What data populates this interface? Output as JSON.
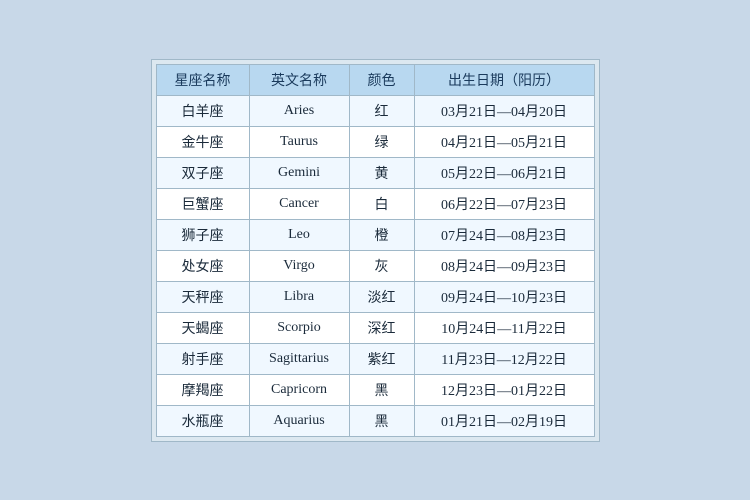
{
  "table": {
    "headers": {
      "chinese_name": "星座名称",
      "english_name": "英文名称",
      "color": "颜色",
      "birth_date": "出生日期（阳历）"
    },
    "rows": [
      {
        "chinese": "白羊座",
        "english": "Aries",
        "color": "红",
        "date": "03月21日—04月20日"
      },
      {
        "chinese": "金牛座",
        "english": "Taurus",
        "color": "绿",
        "date": "04月21日—05月21日"
      },
      {
        "chinese": "双子座",
        "english": "Gemini",
        "color": "黄",
        "date": "05月22日—06月21日"
      },
      {
        "chinese": "巨蟹座",
        "english": "Cancer",
        "color": "白",
        "date": "06月22日—07月23日"
      },
      {
        "chinese": "狮子座",
        "english": "Leo",
        "color": "橙",
        "date": "07月24日—08月23日"
      },
      {
        "chinese": "处女座",
        "english": "Virgo",
        "color": "灰",
        "date": "08月24日—09月23日"
      },
      {
        "chinese": "天秤座",
        "english": "Libra",
        "color": "淡红",
        "date": "09月24日—10月23日"
      },
      {
        "chinese": "天蝎座",
        "english": "Scorpio",
        "color": "深红",
        "date": "10月24日—11月22日"
      },
      {
        "chinese": "射手座",
        "english": "Sagittarius",
        "color": "紫红",
        "date": "11月23日—12月22日"
      },
      {
        "chinese": "摩羯座",
        "english": "Capricorn",
        "color": "黑",
        "date": "12月23日—01月22日"
      },
      {
        "chinese": "水瓶座",
        "english": "Aquarius",
        "color": "黑",
        "date": "01月21日—02月19日"
      }
    ]
  }
}
